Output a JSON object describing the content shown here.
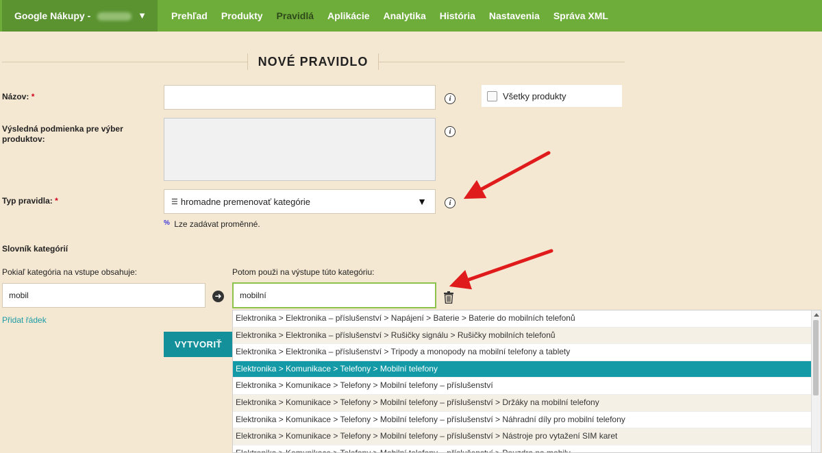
{
  "header": {
    "shop_name": "Google Nákupy -",
    "nav": [
      {
        "label": "Prehľad",
        "active": false
      },
      {
        "label": "Produkty",
        "active": false
      },
      {
        "label": "Pravidlá",
        "active": true
      },
      {
        "label": "Aplikácie",
        "active": false
      },
      {
        "label": "Analytika",
        "active": false
      },
      {
        "label": "História",
        "active": false
      },
      {
        "label": "Nastavenia",
        "active": false
      },
      {
        "label": "Správa XML",
        "active": false
      }
    ]
  },
  "page": {
    "title": "NOVÉ PRAVIDLO"
  },
  "form": {
    "name_label": "Názov:",
    "name_value": "",
    "condition_label": "Výsledná podmienka pre výber produktov:",
    "condition_value": "",
    "all_products_label": "Všetky produkty",
    "all_products_checked": false,
    "rule_type_label": "Typ pravidla:",
    "rule_type_value": "hromadne premenovať kategórie",
    "hint_symbol": "%",
    "hint_text": "Lze zadávat proměnné.",
    "required_mark": "*",
    "dict_title": "Slovník kategórií",
    "input_col_label": "Pokiaľ kategória na vstupe obsahuje:",
    "output_col_label": "Potom použi na výstupe túto kategóriu:",
    "input_value": "mobil",
    "output_value": "mobilní",
    "add_row_link": "Přidat řádek",
    "create_button": "VYTVORIŤ"
  },
  "dropdown": {
    "items": [
      "Elektronika > Elektronika – příslušenství > Napájení > Baterie > Baterie do mobilních telefonů",
      "Elektronika > Elektronika – příslušenství > Rušičky signálu > Rušičky mobilních telefonů",
      "Elektronika > Elektronika – příslušenství > Tripody a monopody na mobilní telefony a tablety",
      "Elektronika > Komunikace > Telefony > Mobilní telefony",
      "Elektronika > Komunikace > Telefony > Mobilní telefony – příslušenství",
      "Elektronika > Komunikace > Telefony > Mobilní telefony – příslušenství > Držáky na mobilní telefony",
      "Elektronika > Komunikace > Telefony > Mobilní telefony – příslušenství > Náhradní díly pro mobilní telefony",
      "Elektronika > Komunikace > Telefony > Mobilní telefony – příslušenství > Nástroje pro vytažení SIM karet",
      "Elektronika > Komunikace > Telefony > Mobilní telefony – příslušenství > Pouzdra na mobily"
    ],
    "selected_index": 3
  },
  "colors": {
    "header_bg": "#6fad3a",
    "accent_teal": "#149aa6",
    "page_bg": "#f5e8d3",
    "annotation_red": "#e01b1b"
  }
}
